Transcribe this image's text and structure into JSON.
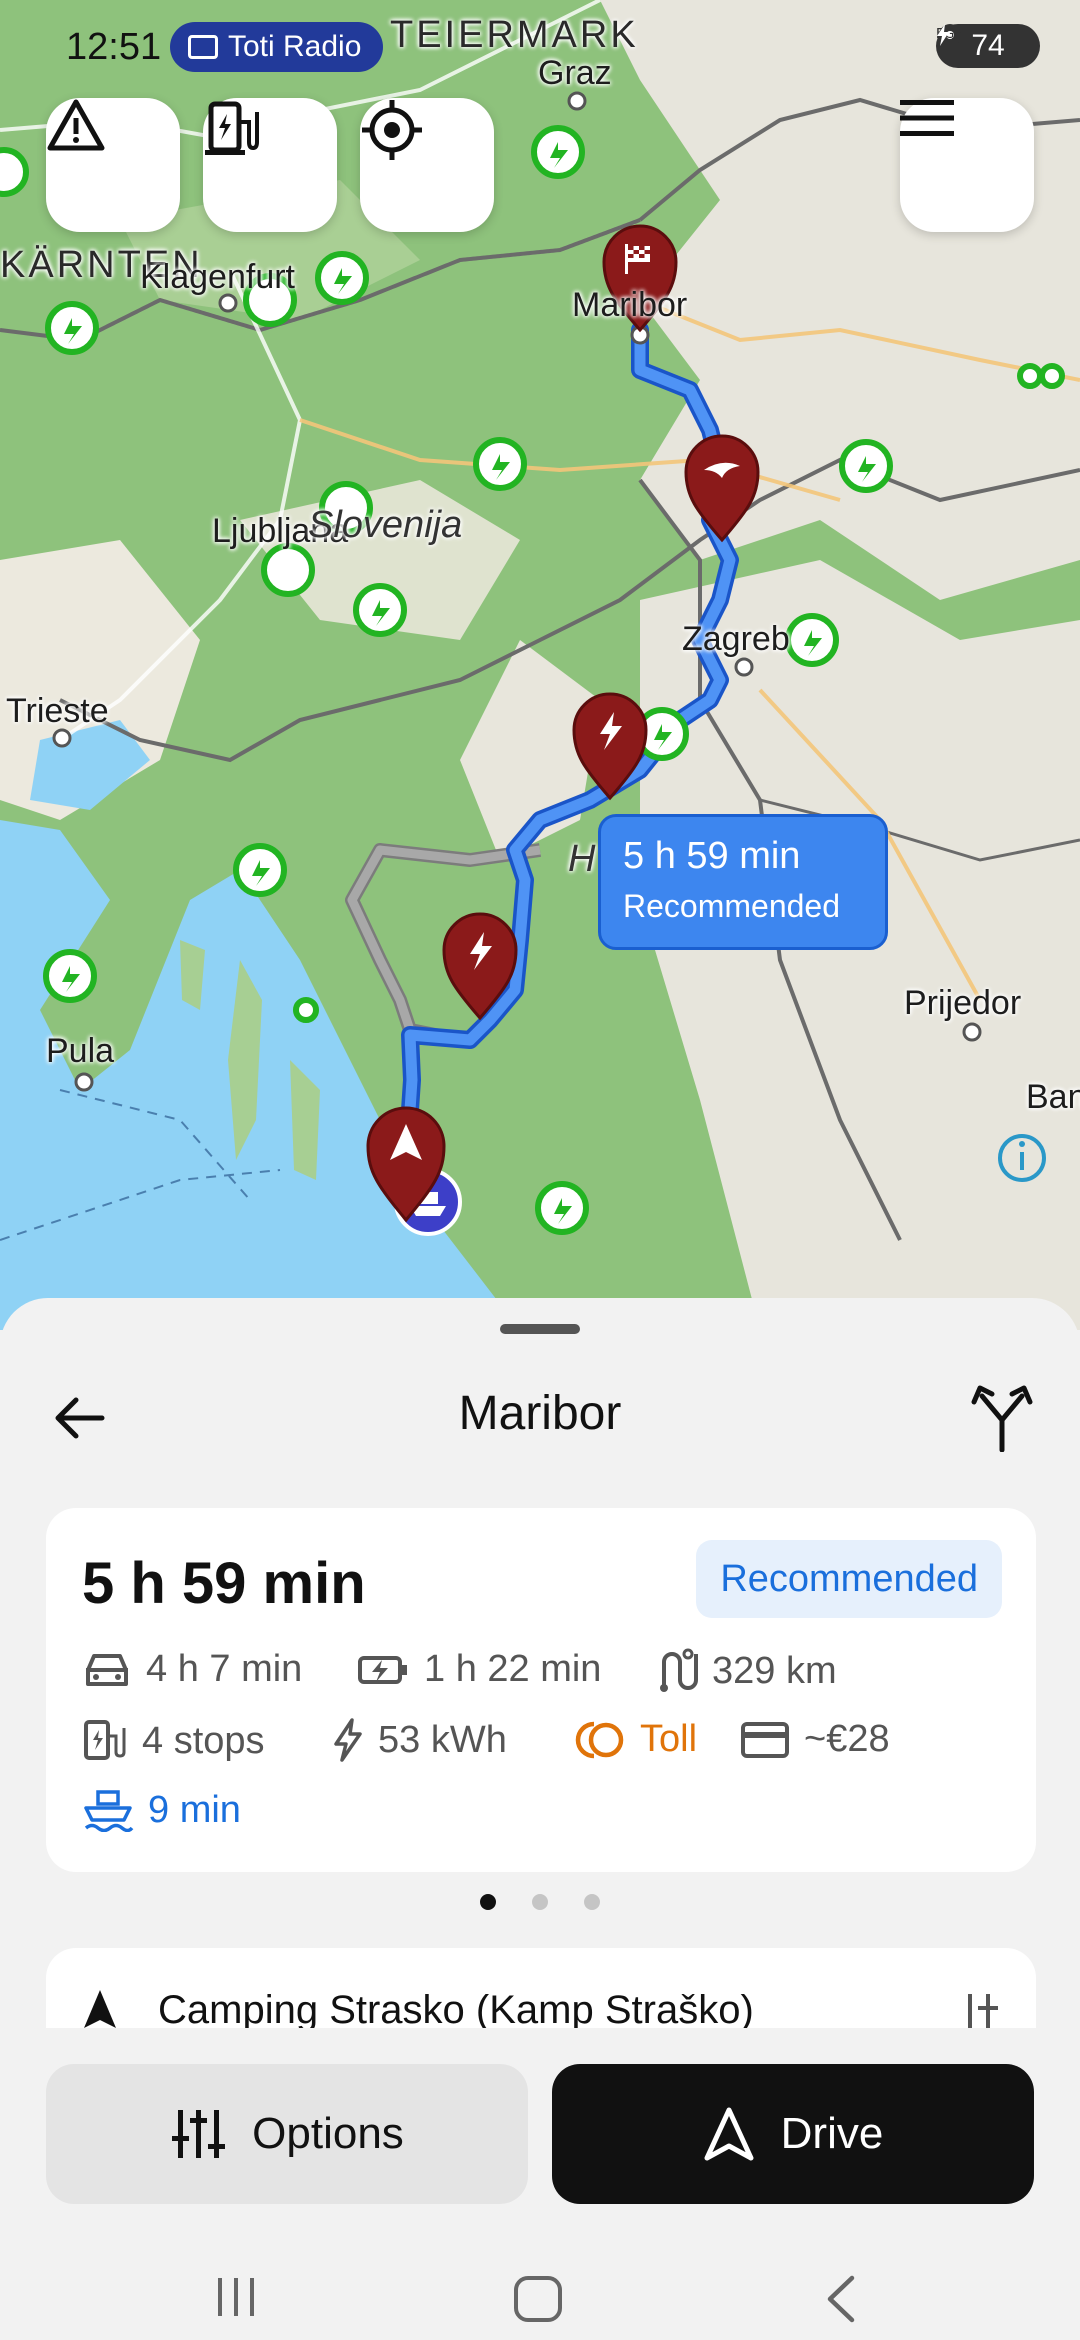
{
  "status_bar": {
    "time": "12:51",
    "radio_label": "Toti Radio",
    "battery": "74"
  },
  "map": {
    "labels": {
      "steiermark": "TEIERMARK",
      "graz": "Graz",
      "karnten": "KÄRNTEN",
      "klagenfurt": "Klagenfurt",
      "maribor": "Maribor",
      "ljubljana": "Ljubljana",
      "slovenija": "Slovenija",
      "zagreb": "Zagreb",
      "trieste": "Trieste",
      "pula": "Pula",
      "prijedor": "Prijedor",
      "ban": "Ban",
      "h": "H"
    },
    "route_bubble": {
      "duration": "5 h 59 min",
      "tag": "Recommended"
    },
    "colors": {
      "route": "#3d86ef",
      "alt_route": "#8e8e8e",
      "marker": "#8b1a1a",
      "charger": "#2db82d",
      "sea": "#8fd2f5"
    }
  },
  "sheet": {
    "destination": "Maribor",
    "route": {
      "duration": "5 h 59 min",
      "badge": "Recommended",
      "drive_time": "4 h 7 min",
      "charge_time": "1 h 22 min",
      "distance": "329 km",
      "stops": "4 stops",
      "energy": "53 kWh",
      "toll": "Toll",
      "cost": "~€28",
      "ferry_time": "9 min"
    },
    "next_stop": "Camping Strasko (Kamp Straško)",
    "options_label": "Options",
    "drive_label": "Drive"
  }
}
